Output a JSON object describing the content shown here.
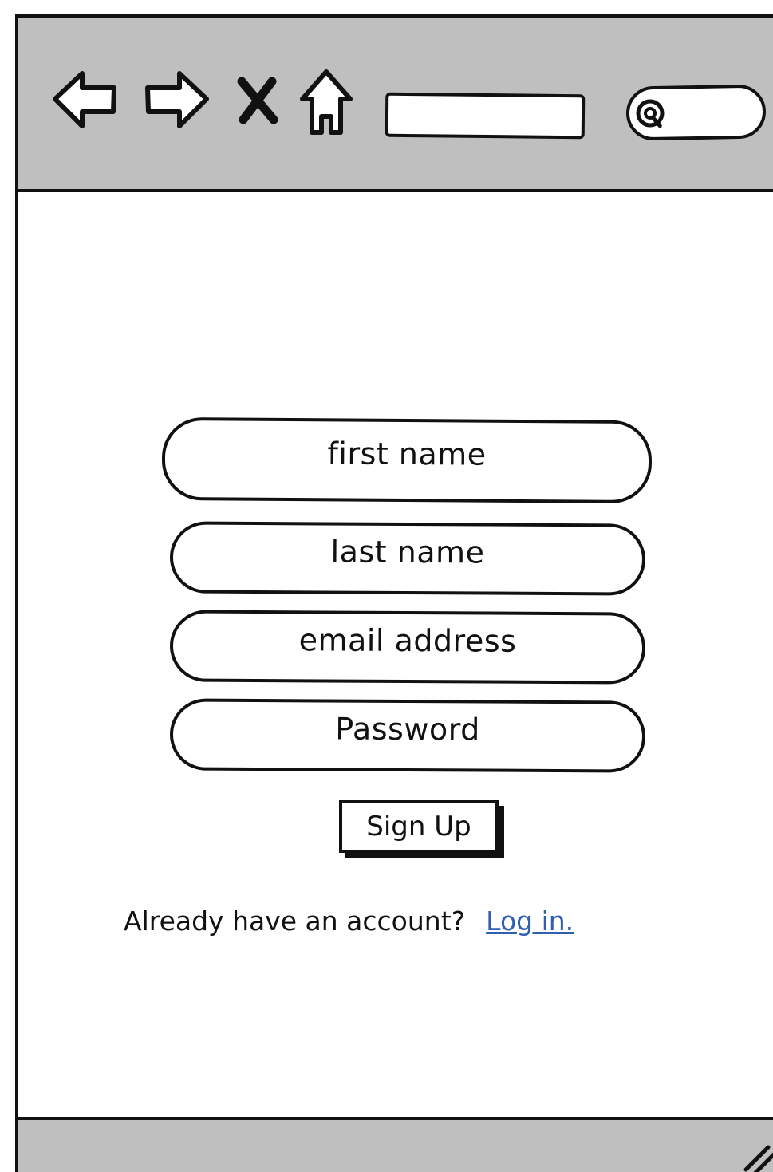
{
  "toolbar": {
    "icons": [
      "back-arrow-icon",
      "forward-arrow-icon",
      "close-icon",
      "home-icon",
      "search-icon"
    ],
    "address_bar_value": "",
    "search_value": ""
  },
  "form": {
    "first_name_placeholder": "first name",
    "last_name_placeholder": "last name",
    "email_placeholder": "email address",
    "password_placeholder": "Password",
    "signup_label": "Sign Up"
  },
  "login_prompt": {
    "text": "Already have an account?",
    "link_label": "Log in."
  },
  "colors": {
    "toolbar_bg": "#bfbfbf",
    "stroke": "#111111",
    "link": "#2f5fb0"
  },
  "statusbar": {
    "icons": [
      "resize-grip-icon"
    ]
  }
}
